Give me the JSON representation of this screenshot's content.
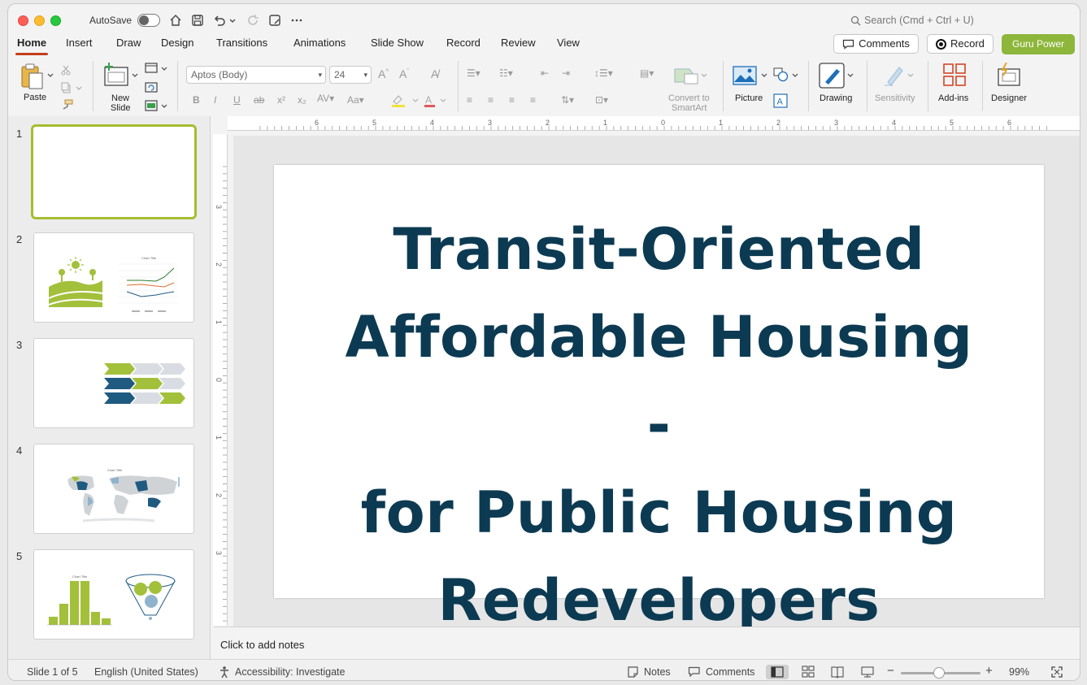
{
  "titlebar": {
    "autosave_label": "AutoSave",
    "search_placeholder": "Search (Cmd + Ctrl + U)"
  },
  "tabs": [
    "Home",
    "Insert",
    "Draw",
    "Design",
    "Transitions",
    "Animations",
    "Slide Show",
    "Record",
    "Review",
    "View"
  ],
  "active_tab": "Home",
  "header_buttons": {
    "comments": "Comments",
    "record": "Record",
    "guru": "Guru Power"
  },
  "ribbon": {
    "paste": "Paste",
    "new_slide_line1": "New",
    "new_slide_line2": "Slide",
    "font_name": "Aptos (Body)",
    "font_size": "24",
    "convert_line1": "Convert to",
    "convert_line2": "SmartArt",
    "picture": "Picture",
    "drawing": "Drawing",
    "sensitivity": "Sensitivity",
    "addins": "Add-ins",
    "designer": "Designer"
  },
  "ruler": {
    "h_labels": [
      "6",
      "5",
      "4",
      "3",
      "2",
      "1",
      "0",
      "1",
      "2",
      "3",
      "4",
      "5",
      "6"
    ],
    "v_labels": [
      "3",
      "2",
      "1",
      "0",
      "1",
      "2",
      "3"
    ]
  },
  "thumbnails": [
    {
      "num": "1"
    },
    {
      "num": "2",
      "chart_title": "Chart Title"
    },
    {
      "num": "3"
    },
    {
      "num": "4",
      "chart_title": "Chart Title"
    },
    {
      "num": "5",
      "chart_title": "Chart Title"
    }
  ],
  "slide": {
    "title_lines": [
      "Transit-Oriented",
      "Affordable Housing -",
      "for Public Housing",
      "Redevelopers"
    ]
  },
  "notes_placeholder": "Click to add notes",
  "status": {
    "slide_of": "Slide 1 of 5",
    "language": "English (United States)",
    "accessibility": "Accessibility: Investigate",
    "notes": "Notes",
    "comments": "Comments",
    "zoom": "99%"
  },
  "colors": {
    "accent_tab": "#c43e1c",
    "guru_green": "#8db63a",
    "title_navy": "#0c3a52",
    "thumb_selected": "#a7bd2f"
  }
}
